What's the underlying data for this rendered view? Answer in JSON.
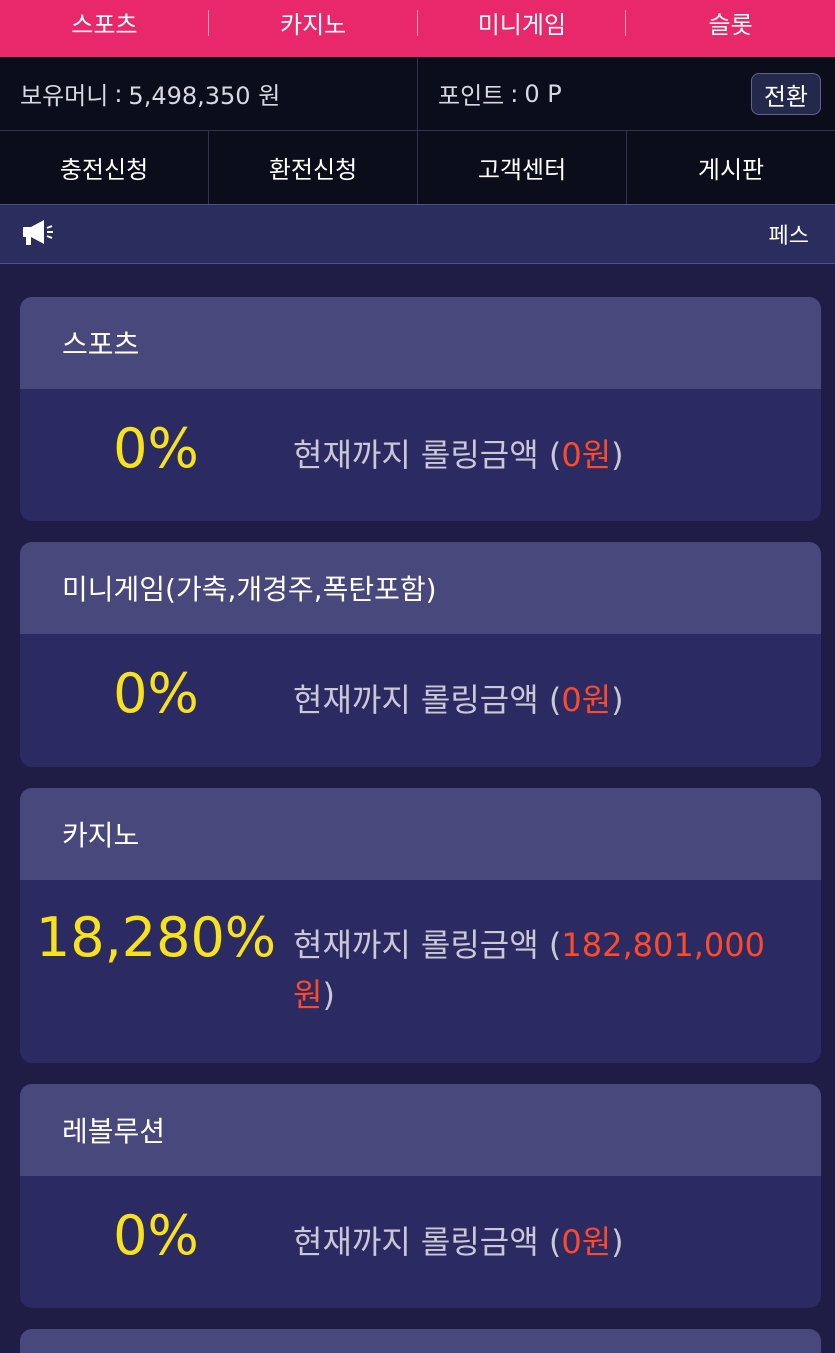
{
  "top_nav": [
    "스포츠",
    "카지노",
    "미니게임",
    "슬롯"
  ],
  "balance": {
    "label": "보유머니",
    "separator": ":",
    "value": "5,498,350 원"
  },
  "points": {
    "label": "포인트",
    "separator": ":",
    "value": "0 P",
    "switch_label": "전환"
  },
  "menu": [
    "충전신청",
    "환전신청",
    "고객센터",
    "게시판"
  ],
  "notice": {
    "icon": "megaphone-icon",
    "text": "페스"
  },
  "cards": [
    {
      "title": "스포츠",
      "percent": "0%",
      "desc_prefix": "현재까지 롤링금액 (",
      "amount": "0원",
      "desc_suffix": ")"
    },
    {
      "title": "미니게임(가축,개경주,폭탄포함)",
      "percent": "0%",
      "desc_prefix": "현재까지 롤링금액 (",
      "amount": "0원",
      "desc_suffix": ")"
    },
    {
      "title": "카지노",
      "percent": "18,280%",
      "desc_prefix": "현재까지 롤링금액 (",
      "amount": "182,801,000원",
      "desc_suffix": ")"
    },
    {
      "title": "레볼루션",
      "percent": "0%",
      "desc_prefix": "현재까지 롤링금액 (",
      "amount": "0원",
      "desc_suffix": ")"
    }
  ],
  "colors": {
    "brand_pink": "#e8286b",
    "percent_yellow": "#f7e21c",
    "amount_red": "#ff4a2a",
    "card_head": "#48487c",
    "card_body": "#2b2a62"
  }
}
